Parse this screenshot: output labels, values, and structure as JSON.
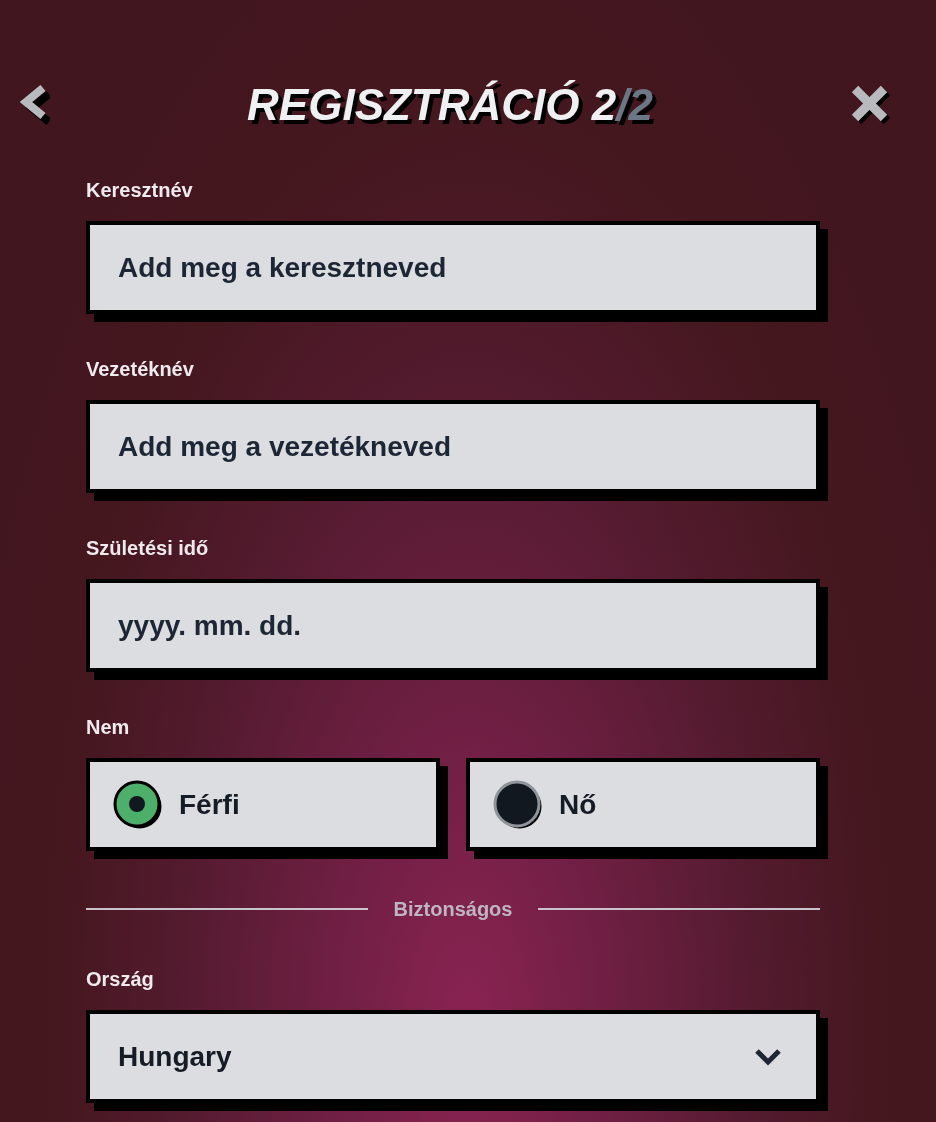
{
  "header": {
    "title": "REGISZTRÁCIÓ 2",
    "title_suffix": "/2"
  },
  "fields": [
    {
      "label": "Keresztnév",
      "placeholder": "Add meg a keresztneved"
    },
    {
      "label": "Vezetéknév",
      "placeholder": "Add meg a vezetékneved"
    },
    {
      "label": "Születési idő",
      "placeholder": "yyyy. mm. dd."
    }
  ],
  "gender": {
    "label": "Nem",
    "options": [
      {
        "label": "Férfi",
        "selected": true
      },
      {
        "label": "Nő",
        "selected": false
      }
    ]
  },
  "divider": {
    "label": "Biztonságos"
  },
  "country": {
    "label": "Ország",
    "value": "Hungary"
  }
}
